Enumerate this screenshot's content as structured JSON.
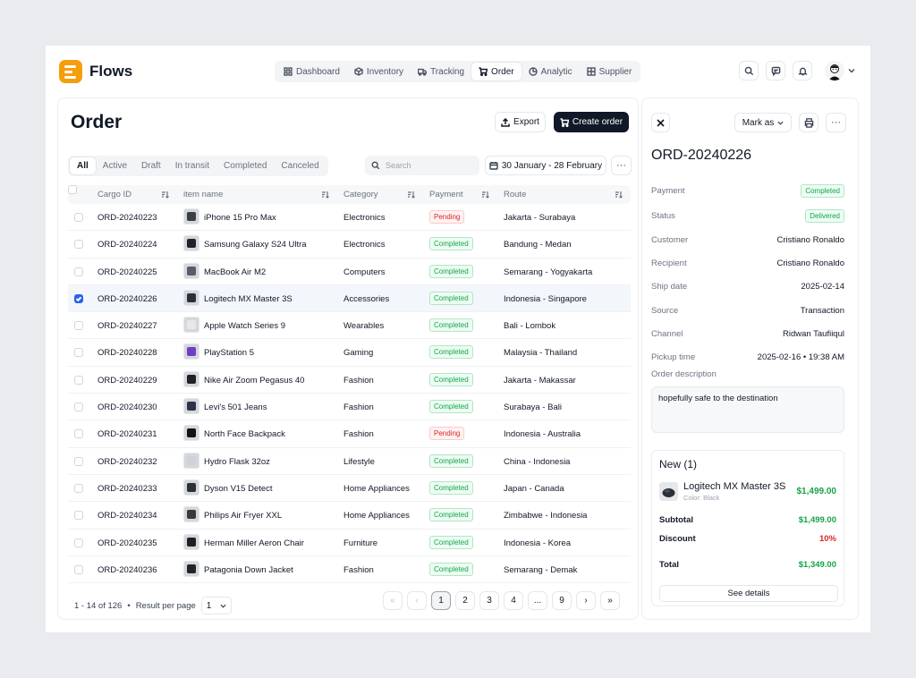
{
  "app": {
    "brand": "Flows"
  },
  "nav": [
    {
      "label": "Dashboard",
      "icon": "grid-icon"
    },
    {
      "label": "Inventory",
      "icon": "box-icon"
    },
    {
      "label": "Tracking",
      "icon": "truck-icon"
    },
    {
      "label": "Order",
      "icon": "cart-icon",
      "active": true
    },
    {
      "label": "Analytic",
      "icon": "chart-pie-icon"
    },
    {
      "label": "Supplier",
      "icon": "building-icon"
    }
  ],
  "header_icons": [
    "search-icon",
    "message-icon",
    "bell-icon"
  ],
  "page": {
    "title": "Order",
    "export_label": "Export",
    "create_label": "Create order"
  },
  "tabs": [
    {
      "label": "All",
      "active": true
    },
    {
      "label": "Active"
    },
    {
      "label": "Draft"
    },
    {
      "label": "In transit"
    },
    {
      "label": "Completed"
    },
    {
      "label": "Canceled"
    }
  ],
  "search": {
    "placeholder": "Search"
  },
  "date_range": "30 January - 28 February",
  "table": {
    "columns": [
      "Cargo ID",
      "item name",
      "Category",
      "Payment",
      "Route"
    ],
    "rows": [
      {
        "id": "ORD-20240223",
        "name": "iPhone 15 Pro Max",
        "category": "Electronics",
        "payment": "Pending",
        "route": "Jakarta - Surabaya"
      },
      {
        "id": "ORD-20240224",
        "name": "Samsung Galaxy S24 Ultra",
        "category": "Electronics",
        "payment": "Completed",
        "route": "Bandung - Medan"
      },
      {
        "id": "ORD-20240225",
        "name": "MacBook Air M2",
        "category": "Computers",
        "payment": "Completed",
        "route": "Semarang - Yogyakarta"
      },
      {
        "id": "ORD-20240226",
        "name": "Logitech MX Master 3S",
        "category": "Accessories",
        "payment": "Completed",
        "route": "Indonesia - Singapore",
        "selected": true
      },
      {
        "id": "ORD-20240227",
        "name": "Apple Watch Series 9",
        "category": "Wearables",
        "payment": "Completed",
        "route": "Bali - Lombok"
      },
      {
        "id": "ORD-20240228",
        "name": "PlayStation 5",
        "category": "Gaming",
        "payment": "Completed",
        "route": "Malaysia - Thailand"
      },
      {
        "id": "ORD-20240229",
        "name": "Nike Air Zoom Pegasus 40",
        "category": "Fashion",
        "payment": "Completed",
        "route": "Jakarta - Makassar"
      },
      {
        "id": "ORD-20240230",
        "name": "Levi's 501 Jeans",
        "category": "Fashion",
        "payment": "Completed",
        "route": "Surabaya - Bali"
      },
      {
        "id": "ORD-20240231",
        "name": "North Face Backpack",
        "category": "Fashion",
        "payment": "Pending",
        "route": "Indonesia - Australia"
      },
      {
        "id": "ORD-20240232",
        "name": "Hydro Flask 32oz",
        "category": "Lifestyle",
        "payment": "Completed",
        "route": "China - Indonesia"
      },
      {
        "id": "ORD-20240233",
        "name": "Dyson V15 Detect",
        "category": "Home Appliances",
        "payment": "Completed",
        "route": "Japan - Canada"
      },
      {
        "id": "ORD-20240234",
        "name": "Philips Air Fryer XXL",
        "category": "Home Appliances",
        "payment": "Completed",
        "route": "Zimbabwe - Indonesia"
      },
      {
        "id": "ORD-20240235",
        "name": "Herman Miller Aeron Chair",
        "category": "Furniture",
        "payment": "Completed",
        "route": "Indonesia - Korea"
      },
      {
        "id": "ORD-20240236",
        "name": "Patagonia Down Jacket",
        "category": "Fashion",
        "payment": "Completed",
        "route": "Semarang - Demak"
      }
    ]
  },
  "pagination": {
    "range_text": "1 - 14 of 126",
    "per_page_label": "Result per page",
    "per_page_value": "1",
    "pages": [
      "1",
      "2",
      "3",
      "4",
      "...",
      "9"
    ],
    "current": "1"
  },
  "detail": {
    "order_id": "ORD-20240226",
    "mark_as_label": "Mark as",
    "fields": [
      {
        "label": "Payment",
        "value": "Completed",
        "badge": true
      },
      {
        "label": "Status",
        "value": "Delivered",
        "badge": true
      },
      {
        "label": "Customer",
        "value": "Cristiano Ronaldo"
      },
      {
        "label": "Recipient",
        "value": "Cristiano Ronaldo"
      },
      {
        "label": "Ship date",
        "value": "2025-02-14"
      },
      {
        "label": "Source",
        "value": "Transaction"
      },
      {
        "label": "Channel",
        "value": "Ridwan Taufiiqul"
      },
      {
        "label": "Pickup time",
        "value": "2025-02-16 • 19:38 AM"
      }
    ],
    "description_label": "Order description",
    "description": "hopefully safe to the destination",
    "new_title": "New (1)",
    "item": {
      "name": "Logitech MX Master 3S",
      "variant": "Color: Black",
      "price": "$1,499.00"
    },
    "subtotal_label": "Subtotal",
    "subtotal": "$1,499.00",
    "discount_label": "Discount",
    "discount": "10%",
    "total_label": "Total",
    "total": "$1,349.00",
    "see_details_label": "See details"
  },
  "colors": {
    "accent": "#f59e0b",
    "primary_button": "#111827",
    "success": "#16a34a",
    "danger": "#dc2626",
    "selected_check": "#2563eb"
  }
}
